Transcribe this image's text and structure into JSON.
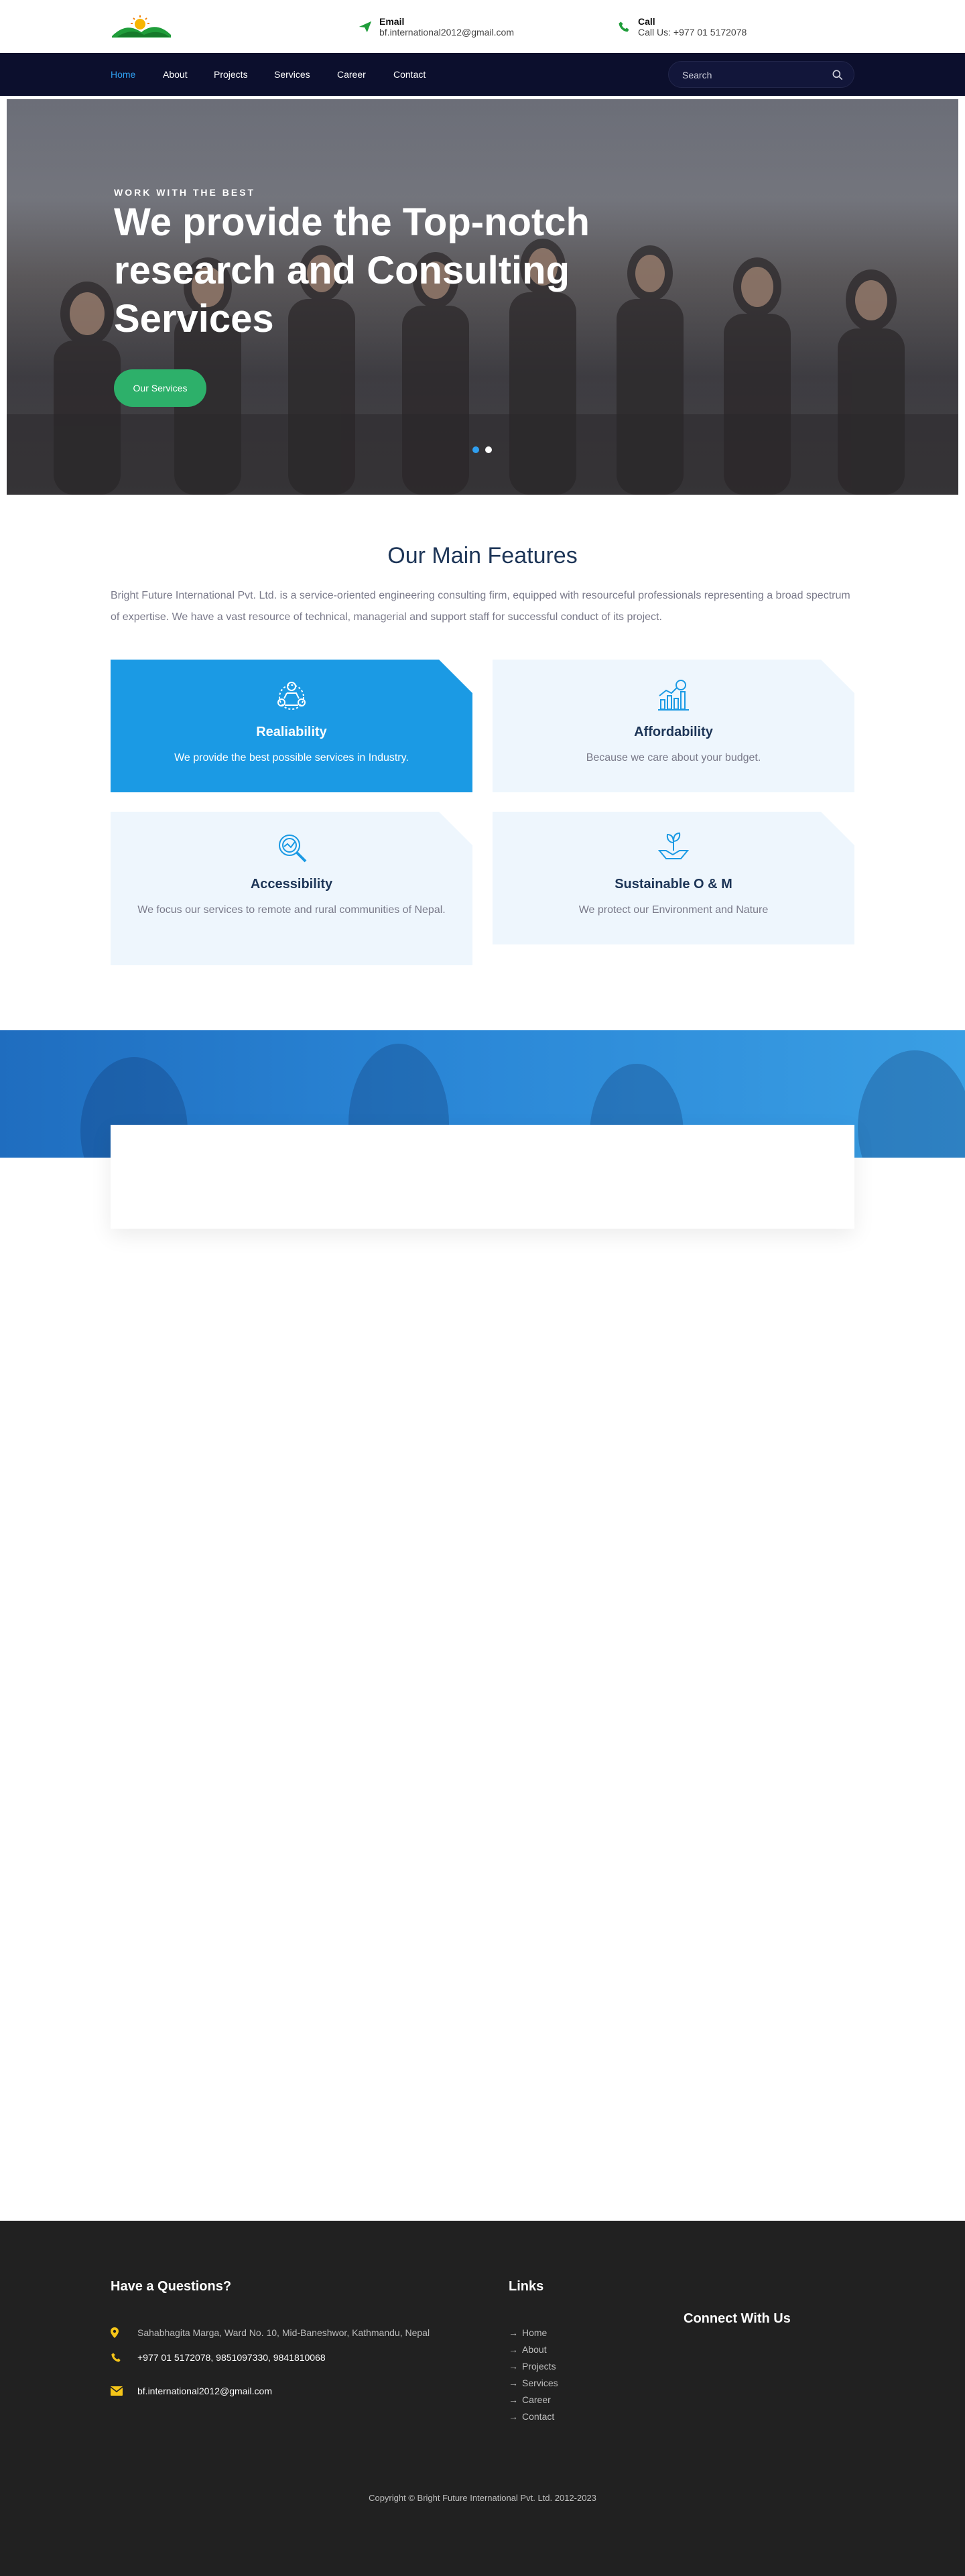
{
  "header": {
    "email_label": "Email",
    "email_value": "bf.international2012@gmail.com",
    "call_label": "Call",
    "call_value": "Call Us: +977 01 5172078"
  },
  "nav": {
    "items": [
      "Home",
      "About",
      "Projects",
      "Services",
      "Career",
      "Contact"
    ],
    "active": "Home",
    "search_placeholder": "Search"
  },
  "hero": {
    "subtitle": "WORK WITH THE BEST",
    "title": "We provide the Top-notch research and Consulting Services",
    "button": "Our Services",
    "slides": 2,
    "active_slide": 1
  },
  "features": {
    "title": "Our Main Features",
    "intro": "Bright Future International Pvt. Ltd. is a service-oriented engineering consulting firm, equipped with resourceful professionals representing a broad spectrum of expertise. We have a vast resource of technical, managerial and support staff for successful conduct of its project.",
    "cards": [
      {
        "title": "Realiability",
        "text": "We provide the best possible services in Industry.",
        "icon": "team-network-icon"
      },
      {
        "title": "Affordability",
        "text": "Because we care about your budget.",
        "icon": "growth-chart-icon"
      },
      {
        "title": "Accessibility",
        "text": "We focus our services to remote and rural communities of Nepal.",
        "icon": "magnifier-icon"
      },
      {
        "title": "Sustainable O & M",
        "text": "We protect our Environment and Nature",
        "icon": "plant-hand-icon"
      }
    ]
  },
  "footer": {
    "questions_title": "Have a Questions?",
    "address": "Sahabhagita Marga, Ward No. 10, Mid-Baneshwor, Kathmandu, Nepal",
    "phones": "+977 01 5172078, 9851097330, 9841810068",
    "email": "bf.international2012@gmail.com",
    "links_title": "Links",
    "links": [
      "Home",
      "About",
      "Projects",
      "Services",
      "Career",
      "Contact"
    ],
    "connect_title": "Connect With Us",
    "copyright": "Copyright © Bright Future International Pvt. Ltd. 2012-2023"
  },
  "colors": {
    "nav_bg": "#0c0f2d",
    "accent_blue": "#1b9ae4",
    "button_green": "#2db06a",
    "footer_bg": "#212121",
    "icon_yellow": "#f5c518"
  }
}
